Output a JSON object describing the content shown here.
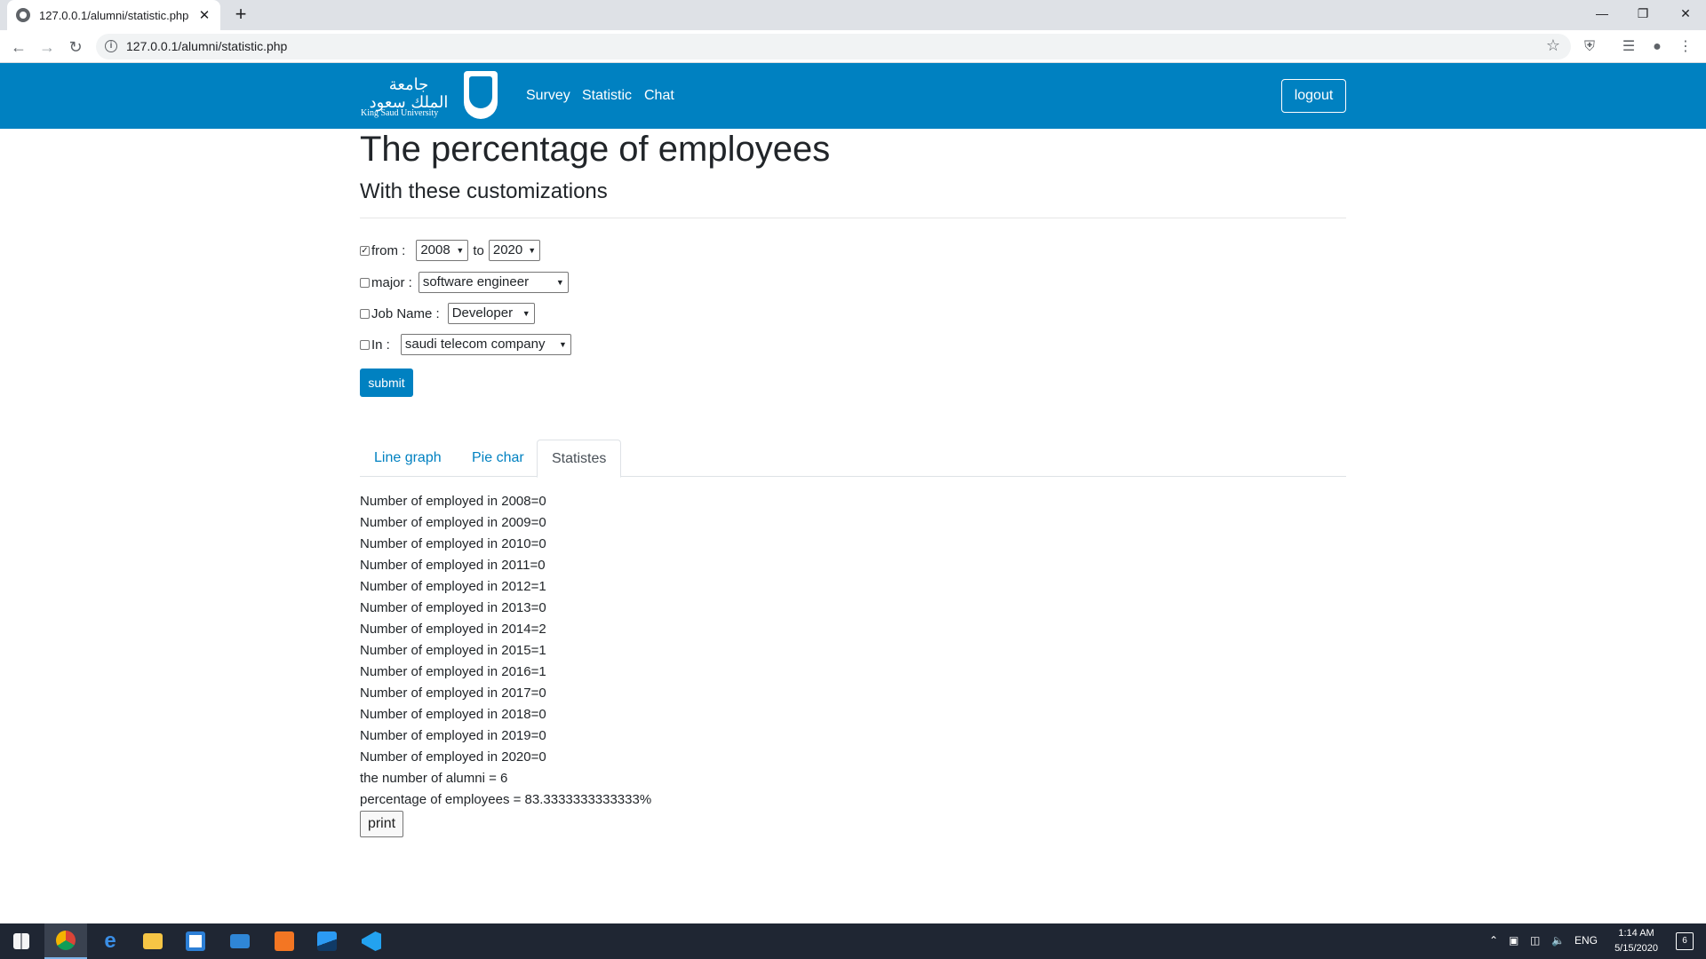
{
  "browser": {
    "tab_title": "127.0.0.1/alumni/statistic.php",
    "tab_close": "✕",
    "new_tab": "+",
    "url": "127.0.0.1/alumni/statistic.php"
  },
  "site_nav": {
    "logo_arabic_line1": "جامعة",
    "logo_arabic_line2": "الملك سعود",
    "logo_english": "King Saud University",
    "links": [
      "Survey",
      "Statistic",
      "Chat"
    ],
    "logout": "logout"
  },
  "page": {
    "title": "The percentage of employees",
    "subtitle": "With these customizations"
  },
  "filters": {
    "from_label": "from :",
    "from_checked": true,
    "from_year": "2008",
    "to_label": "to",
    "to_year": "2020",
    "major_label": "major :",
    "major_checked": false,
    "major_value": "software engineer",
    "job_label": "Job Name :",
    "job_checked": false,
    "job_value": "Developer",
    "in_label": "In :",
    "in_checked": false,
    "in_value": "saudi telecom company",
    "submit": "submit"
  },
  "tabs": {
    "items": [
      "Line graph",
      "Pie char",
      "Statistes"
    ],
    "active": "Statistes"
  },
  "stats": {
    "lines": [
      "Number of employed in 2008=0",
      "Number of employed in 2009=0",
      "Number of employed in 2010=0",
      "Number of employed in 2011=0",
      "Number of employed in 2012=1",
      "Number of employed in 2013=0",
      "Number of employed in 2014=2",
      "Number of employed in 2015=1",
      "Number of employed in 2016=1",
      "Number of employed in 2017=0",
      "Number of employed in 2018=0",
      "Number of employed in 2019=0",
      "Number of employed in 2020=0"
    ],
    "alumni_line": "the number of alumni = 6",
    "percentage_line": "percentage of employees = 83.3333333333333%",
    "print": "print"
  },
  "taskbar": {
    "lang": "ENG",
    "time": "1:14 AM",
    "date": "5/15/2020",
    "notifications": "6"
  },
  "colors": {
    "brand": "#0081c1",
    "taskbar": "#1f2633"
  }
}
